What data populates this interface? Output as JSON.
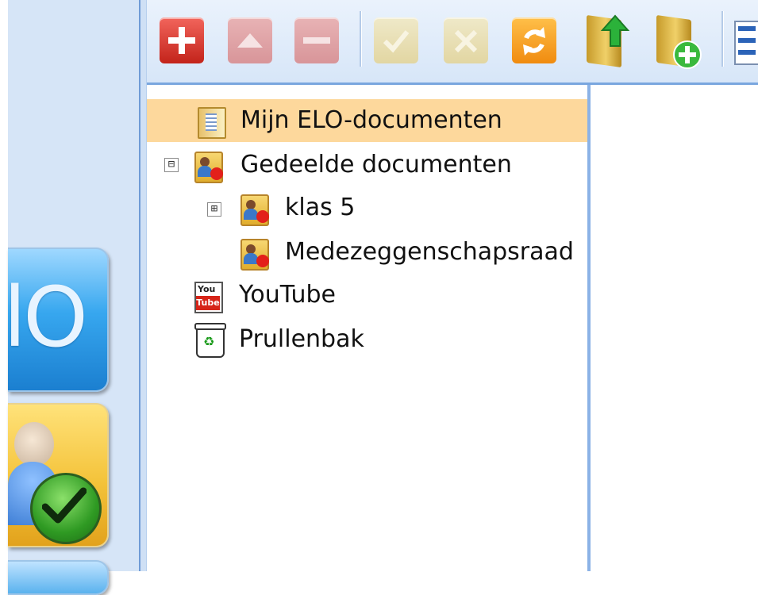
{
  "sidebar": {
    "tiles": [
      {
        "name": "elo-tile",
        "text": "lO",
        "color": "#2b97e6"
      },
      {
        "name": "people-tile",
        "icon": "user-check-icon",
        "color": "#f2bf3a"
      },
      {
        "name": "bottom-tile",
        "color": "#5ab2ee"
      }
    ]
  },
  "toolbar": {
    "buttons": [
      {
        "name": "add-button",
        "icon": "plus-icon",
        "enabled": true
      },
      {
        "name": "move-up-button",
        "icon": "arrow-up-icon",
        "enabled": false
      },
      {
        "name": "remove-button",
        "icon": "minus-icon",
        "enabled": false
      },
      {
        "name": "confirm-button",
        "icon": "check-icon",
        "enabled": false
      },
      {
        "name": "cancel-button",
        "icon": "cross-icon",
        "enabled": false
      },
      {
        "name": "refresh-button",
        "icon": "refresh-icon",
        "enabled": true
      },
      {
        "name": "upload-folder-button",
        "icon": "folder-upload-icon",
        "enabled": true
      },
      {
        "name": "new-folder-button",
        "icon": "folder-add-icon",
        "enabled": true
      },
      {
        "name": "view-list-button",
        "icon": "list-view-icon",
        "enabled": true
      }
    ]
  },
  "tree": {
    "nodes": [
      {
        "label": "Mijn ELO-documenten",
        "icon": "document-folder-icon",
        "selected": true
      },
      {
        "label": "Gedeelde documenten",
        "icon": "shared-folder-icon",
        "expander": "⊟"
      },
      {
        "label": "klas 5",
        "icon": "shared-folder-icon",
        "expander": "⊞"
      },
      {
        "label": "Medezeggenschapsraad",
        "icon": "shared-folder-icon"
      },
      {
        "label": "YouTube",
        "icon": "youtube-icon"
      },
      {
        "label": "Prullenbak",
        "icon": "recycle-bin-icon"
      }
    ],
    "selection_color": "#fdd89c"
  },
  "youtube_icon_text": {
    "top": "You",
    "bottom": "Tube"
  },
  "colors": {
    "panel_border": "#7aa6df",
    "sidebar_bg": "#d6e5f7",
    "accent_red": "#c3231a",
    "accent_orange": "#f08b0f"
  }
}
